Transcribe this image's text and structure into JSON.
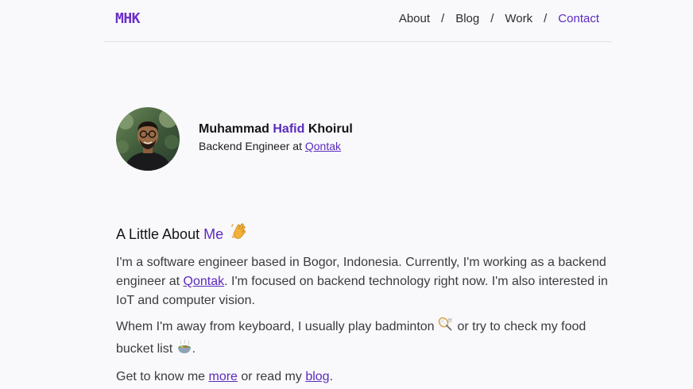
{
  "nav": {
    "logo": "MHK",
    "items": [
      {
        "label": "About"
      },
      {
        "label": "Blog"
      },
      {
        "label": "Work"
      },
      {
        "label": "Contact"
      }
    ],
    "separator": "/"
  },
  "profile": {
    "name_first": "Muhammad",
    "name_middle": "Hafid",
    "name_last": "Khoirul",
    "role_prefix": "Backend Engineer at",
    "company": "Qontak"
  },
  "about": {
    "heading_prefix": "A Little About",
    "heading_accent": "Me",
    "heading_icon": "waving-hand-icon",
    "p1_part1": "I'm a software engineer based in Bogor, Indonesia. Currently, I'm working as a backend engineer at",
    "p1_link": "Qontak",
    "p1_part2": ". I'm focused on backend technology right now. I'm also interested in IoT and computer vision.",
    "p2_part1": "Whem I'm away from keyboard, I usually play badminton",
    "p2_icon1": "badminton-icon",
    "p2_part2": "or try to check my food bucket list",
    "p2_icon2": "food-bowl-icon",
    "p2_part3": ".",
    "p3_part1": "Get to know me",
    "p3_link1": "more",
    "p3_part2": "or read my",
    "p3_link2": "blog",
    "p3_part3": "."
  },
  "colors": {
    "accent": "#5b2bbd",
    "logo": "#6b2fc9",
    "background": "#f9f9fb"
  }
}
